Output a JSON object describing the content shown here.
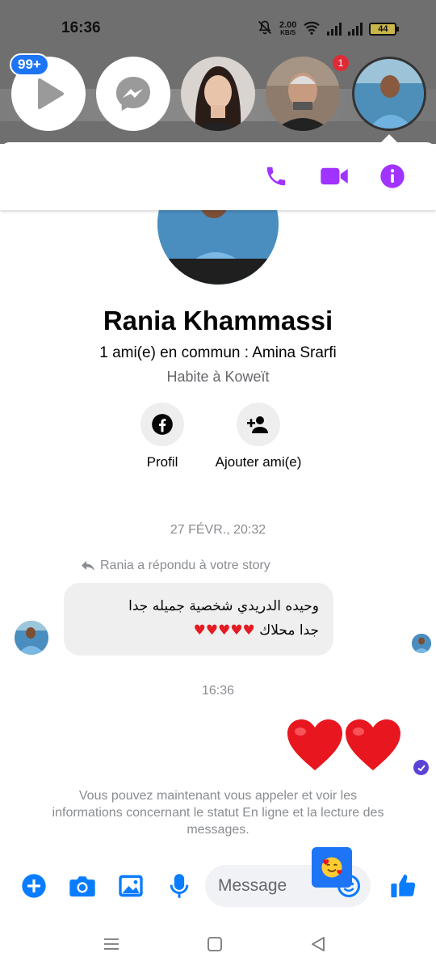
{
  "status_bar": {
    "time": "16:36",
    "net_speed_value": "2.00",
    "net_speed_unit": "KB/S",
    "battery": "44"
  },
  "chat_heads": {
    "unread_badge": "99+",
    "story_badge": "1"
  },
  "header": {
    "icons": [
      "phone-icon",
      "video-call-icon",
      "info-icon"
    ],
    "accent_color": "#a033ff"
  },
  "profile": {
    "name": "Rania Khammassi",
    "mutual_friends": "1 ami(e) en commun : Amina Srarfi",
    "lives_in": "Habite à Koweït",
    "actions": [
      {
        "label": "Profil",
        "icon": "facebook-icon"
      },
      {
        "label": "Ajouter ami(e)",
        "icon": "add-friend-icon"
      }
    ]
  },
  "conversation": {
    "date_1": "27 FÉVR., 20:32",
    "replied_note": "Rania a répondu à votre story",
    "received_message_line1": "وحيده الدريدي شخصية جميله جدا",
    "received_message_line2": "جدا محلاك",
    "received_hearts": "♥♥♥♥♥",
    "time_2": "16:36",
    "sent_message": "❤❤",
    "notice": "Vous pouvez maintenant vous appeler et voir les informations concernant le statut En ligne et la lecture des messages."
  },
  "composer": {
    "placeholder": "Message",
    "icons": [
      "plus-icon",
      "camera-icon",
      "gallery-icon",
      "microphone-icon",
      "emoji-icon",
      "like-icon"
    ],
    "accent_color": "#0a7cff"
  }
}
